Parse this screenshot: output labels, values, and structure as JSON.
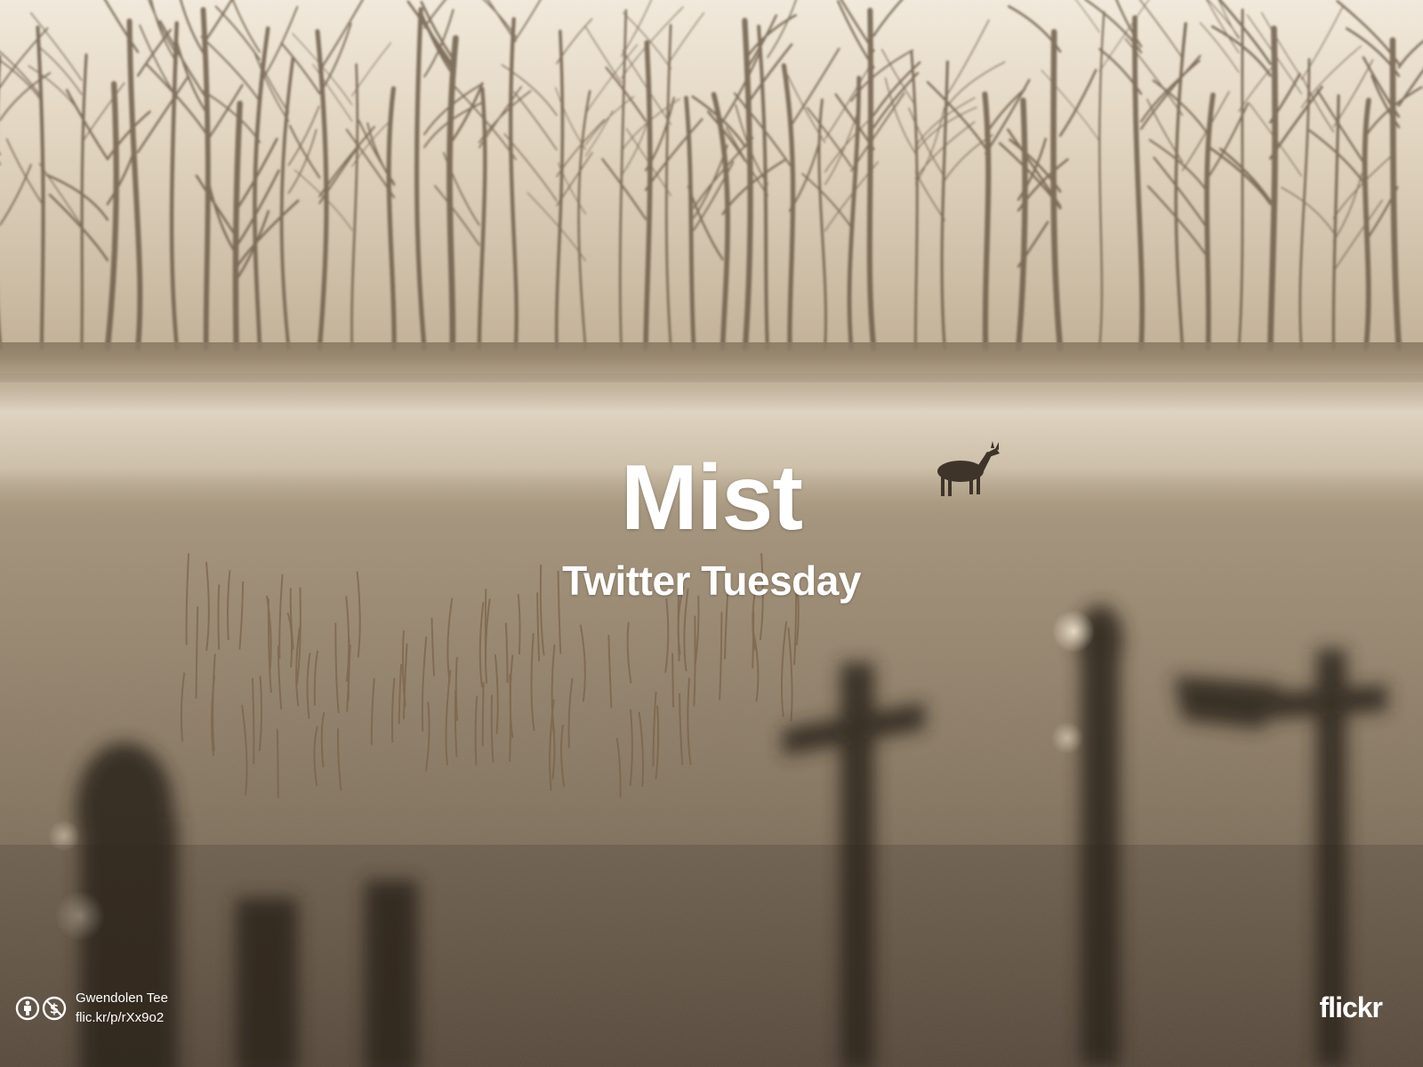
{
  "title": "Mist",
  "subtitle": "Twitter Tuesday",
  "credit": {
    "author": "Gwendolen Tee",
    "url": "flic.kr/p/rXx9o2",
    "license_icons": [
      "cc-attribution-icon",
      "cc-noncommercial-icon"
    ]
  },
  "brand": "flickr",
  "colors": {
    "sky": "#efe6d6",
    "trees": "#6a5a47",
    "mist": "#d9ccb8",
    "field": "#9a8b74",
    "foreground": "#4a3f32",
    "text": "#ffffff"
  }
}
